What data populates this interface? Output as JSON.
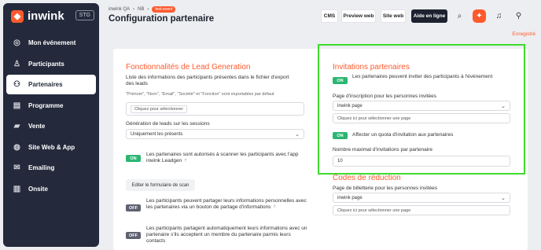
{
  "brand": {
    "name": "inwink",
    "env": "STG"
  },
  "sidebar": {
    "items": [
      {
        "label": "Mon événement",
        "icon": "target-icon"
      },
      {
        "label": "Participants",
        "icon": "person-icon"
      },
      {
        "label": "Partenaires",
        "icon": "partners-icon"
      },
      {
        "label": "Programme",
        "icon": "program-icon"
      },
      {
        "label": "Vente",
        "icon": "cart-icon"
      },
      {
        "label": "Site Web & App",
        "icon": "globe-icon"
      },
      {
        "label": "Emailing",
        "icon": "mail-icon"
      },
      {
        "label": "Onsite",
        "icon": "onsite-icon"
      }
    ],
    "active_index": 2
  },
  "header": {
    "breadcrumb": [
      "inwink QA",
      "NB"
    ],
    "badge": "test-event",
    "title": "Configuration partenaire",
    "buttons": {
      "cms": "CMS",
      "preview": "Preview web",
      "site": "Site web",
      "help": "Aide en ligne"
    },
    "save_status": "Enregistré"
  },
  "leadgen": {
    "title": "Fonctionnalités de Lead Generation",
    "desc": "Liste des informations des participants présentes dans le fichier d'export des leads",
    "note": "\"Prénom\", \"Nom\", \"Email\", \"Société\" et \"Fonction\" sont exportables par défaut",
    "field_placeholder": "Cliquez pour sélectionner",
    "sessions_label": "Génération de leads sur les sessions",
    "sessions_value": "Uniquement les présents",
    "scan_toggle": "ON",
    "scan_label": "Les partenaires sont autorisés à scanner les participants avec l'app inwink Leadgen",
    "scan_form_button": "Editer le formulaire de scan",
    "share_toggle": "OFF",
    "share_label": "Les participants peuvent partager leurs informations personnelles avec les partenaires via un bouton de partage d'informations",
    "auto_toggle": "OFF",
    "auto_label": "Les participants partagent automatiquement leurs informations avec un partenaire s'ils acceptent un membre du partenaire parmis leurs contacts",
    "help_mark": "?"
  },
  "invitations": {
    "title": "Invitations partenaires",
    "invite_toggle": "ON",
    "invite_label": "Les partenaires peuvent inviter des participants à l'événement",
    "page_label": "Page d'inscription pour les personnes invitées",
    "page_value": "inwink page",
    "subpage_placeholder": "Cliquez ici pour sélectionner une page",
    "quota_toggle": "ON",
    "quota_label": "Affecter un quota d'invitation aux partenaires",
    "max_label": "Nombre maximal d'invitations par partenaire",
    "max_value": "10"
  },
  "discounts": {
    "title": "Codes de réduction",
    "page_label": "Page de billetterie pour les personnes invitées",
    "page_value": "inwink page",
    "subpage_placeholder": "Cliquez ici pour sélectionner une page"
  }
}
